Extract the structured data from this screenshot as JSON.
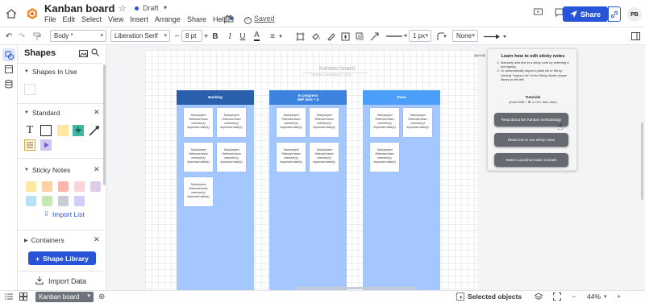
{
  "app": {
    "doc_title": "Kanban board",
    "draft_label": "Draft",
    "saved_label": "Saved",
    "share_label": "Share",
    "avatar_initials": "PB",
    "accent": "#2855d8"
  },
  "menu": [
    "File",
    "Edit",
    "Select",
    "View",
    "Insert",
    "Arrange",
    "Share",
    "Help"
  ],
  "toolbar": {
    "style_select": "Body *",
    "font_select": "Liberation Serif",
    "font_size": "8 pt",
    "line_width": "1 px",
    "arrow_start": "None"
  },
  "panel": {
    "title": "Shapes",
    "sections": {
      "in_use": "Shapes In Use",
      "standard": "Standard",
      "sticky": "Sticky Notes",
      "containers": "Containers"
    },
    "import_list": "Import List",
    "library_button": "Shape Library",
    "import_data": "Import Data",
    "sticky_colors": [
      "#fde7a3",
      "#fdd1a6",
      "#fcb5ab",
      "#fad4dd",
      "#dccde9",
      "#b7e1f7",
      "#c7e8b1",
      "#c9cdd3",
      "#cfcff7"
    ]
  },
  "board": {
    "title": "Kanban board",
    "subtitle": "Pat Bates  |  November 27, 2023",
    "columns": [
      {
        "title": "Backlog",
        "wip": "",
        "header_color": "#2a5fae",
        "cards": 5
      },
      {
        "title": "In progress",
        "wip": "WIP limit = 5",
        "header_color": "#3c83e0",
        "cards": 4
      },
      {
        "title": "Done",
        "wip": "",
        "header_color": "#4b9ff8",
        "cards": 3
      }
    ],
    "card_lines": [
      "Task/project",
      "Relevant team",
      "member(s)",
      "Important date(s)"
    ]
  },
  "learn": {
    "title": "Learn how to edit sticky notes",
    "item1": "Manually add text to a sticky note by selecting it and typing.",
    "item2": "Or automatically import a plain list or file by clicking \"Import List\" in the Sticky Notes shape library to the left.",
    "tutorials_title": "Tutorials",
    "tutorials_hint": "(Hold Shift + ⌘ or Ctrl, then click)",
    "buttons": [
      "Read about the Kanban methodology",
      "Read how to use sticky notes",
      "Watch Lucidchart basic tutorials"
    ]
  },
  "bottom": {
    "page_tab": "Kanban board",
    "selected_objects": "Selected objects",
    "zoom": "44%"
  }
}
